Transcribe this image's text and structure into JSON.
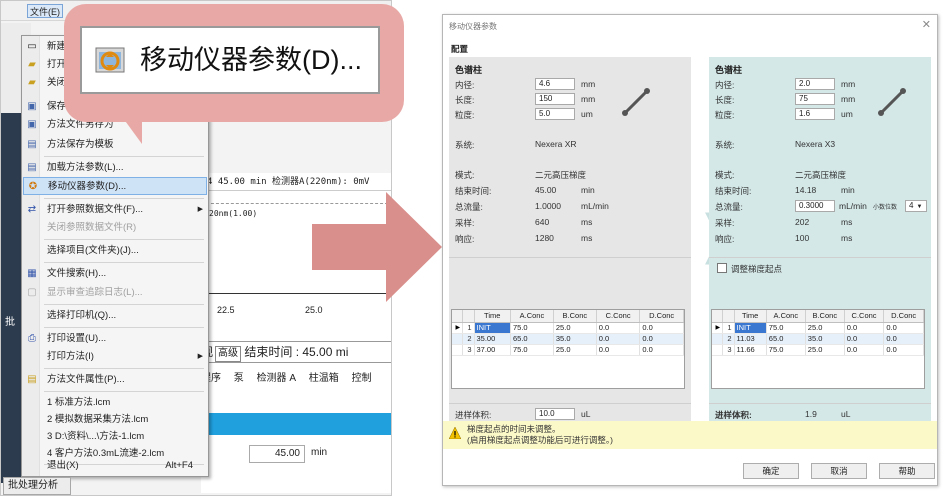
{
  "host_app": {
    "menubar": {
      "file_tab": "文件(E)"
    },
    "background": {
      "header_row": "4 45.00 min 检测器A(220nm): 0mV",
      "chart_label": "20nm(1.00)",
      "ticks": [
        "22.5",
        "25.0"
      ],
      "runtime_row": {
        "prefix": "观",
        "tag": "高级",
        "text": "结束时间 : 45.00 mi"
      },
      "tabs": [
        "程序",
        "泵",
        "检测器 A",
        "柱温箱",
        "控制"
      ],
      "time_value": "45.00",
      "time_unit": "min"
    },
    "bottom_tab": "批处理分析",
    "side_char": "批"
  },
  "file_menu": {
    "items": [
      {
        "label": "新建",
        "icon": "new-file-icon"
      },
      {
        "label": "打开",
        "icon": "open-folder-icon"
      },
      {
        "label": "关闭",
        "icon": "close-file-icon"
      },
      {
        "label": "保存",
        "icon": "save-icon"
      },
      {
        "label": "方法文件另存为",
        "icon": "save-as-icon"
      },
      {
        "label": "方法保存为模板",
        "icon": "template-icon"
      },
      {
        "label": "加载方法参数(L)...",
        "icon": "load-params-icon"
      },
      {
        "label": "移动仪器参数(D)...",
        "icon": "transfer-params-icon"
      },
      {
        "label": "打开参照数据文件(F)...",
        "icon": "reference-file-icon"
      },
      {
        "label": "关闭参照数据文件(R)",
        "icon": ""
      },
      {
        "label": "选择项目(文件夹)(J)...",
        "icon": ""
      },
      {
        "label": "文件搜索(H)...",
        "icon": "file-search-icon"
      },
      {
        "label": "显示审查追踪日志(L)...",
        "icon": "audit-log-icon"
      },
      {
        "label": "选择打印机(Q)...",
        "icon": ""
      },
      {
        "label": "打印设置(U)...",
        "icon": "print-setup-icon"
      },
      {
        "label": "打印方法(I)",
        "icon": ""
      },
      {
        "label": "方法文件属性(P)...",
        "icon": "properties-icon"
      },
      {
        "label": "1 标准方法.lcm",
        "icon": ""
      },
      {
        "label": "2 模拟数据采集方法.lcm",
        "icon": ""
      },
      {
        "label": "3 D:\\资料\\...\\方法-1.lcm",
        "icon": ""
      },
      {
        "label": "4 客户方法0.3mL流速-2.lcm",
        "icon": ""
      },
      {
        "label": "退出(X)",
        "shortcut": "Alt+F4",
        "icon": ""
      }
    ]
  },
  "callout": {
    "text": "移动仪器参数(D)..."
  },
  "dialog": {
    "title": "移动仪器参数",
    "close_glyph": "✕",
    "config_label": "配置",
    "source": {
      "section": "色谱柱",
      "inner_diameter": {
        "label": "内径:",
        "value": "4.6",
        "unit": "mm"
      },
      "length": {
        "label": "长度:",
        "value": "150",
        "unit": "mm"
      },
      "particle": {
        "label": "粒度:",
        "value": "5.0",
        "unit": "um"
      },
      "system": {
        "label": "系统:",
        "value": "Nexera XR"
      },
      "mode": {
        "label": "模式:",
        "value": "二元高压梯度"
      },
      "end_time": {
        "label": "结束时间:",
        "value": "45.00",
        "unit": "min"
      },
      "total_flow": {
        "label": "总流量:",
        "value": "1.0000",
        "unit": "mL/min"
      },
      "sampling": {
        "label": "采样:",
        "value": "640",
        "unit": "ms"
      },
      "response": {
        "label": "响应:",
        "value": "1280",
        "unit": "ms"
      },
      "injection": {
        "label": "进样体积:",
        "value": "10.0",
        "unit": "uL"
      }
    },
    "target": {
      "section": "色谱柱",
      "inner_diameter": {
        "label": "内径:",
        "value": "2.0",
        "unit": "mm"
      },
      "length": {
        "label": "长度:",
        "value": "75",
        "unit": "mm"
      },
      "particle": {
        "label": "粒度:",
        "value": "1.6",
        "unit": "um"
      },
      "system": {
        "label": "系统:",
        "value": "Nexera X3"
      },
      "mode": {
        "label": "模式:",
        "value": "二元高压梯度"
      },
      "end_time": {
        "label": "结束时间:",
        "value": "14.18",
        "unit": "min"
      },
      "total_flow": {
        "label": "总流量:",
        "value": "0.3000",
        "unit": "mL/min"
      },
      "decimal_label": "小数位数",
      "decimal_value": "4",
      "sampling": {
        "label": "采样:",
        "value": "202",
        "unit": "ms"
      },
      "response": {
        "label": "响应:",
        "value": "100",
        "unit": "ms"
      },
      "adjust_gradient": "调整梯度起点",
      "injection": {
        "label": "进样体积:",
        "value": "1.9",
        "unit": "uL"
      }
    },
    "table_headers": [
      "Time",
      "A.Conc",
      "B.Conc",
      "C.Conc",
      "D.Conc"
    ],
    "source_rows": [
      [
        "1",
        "INIT",
        "75.0",
        "25.0",
        "0.0",
        "0.0"
      ],
      [
        "2",
        "35.00",
        "65.0",
        "35.0",
        "0.0",
        "0.0"
      ],
      [
        "3",
        "37.00",
        "75.0",
        "25.0",
        "0.0",
        "0.0"
      ]
    ],
    "target_rows": [
      [
        "1",
        "INIT",
        "75.0",
        "25.0",
        "0.0",
        "0.0"
      ],
      [
        "2",
        "11.03",
        "65.0",
        "35.0",
        "0.0",
        "0.0"
      ],
      [
        "3",
        "11.66",
        "75.0",
        "25.0",
        "0.0",
        "0.0"
      ]
    ],
    "warning_line1": "梯度起点的时间未调整。",
    "warning_line2": "(启用梯度起点调整功能后可进行调整。)",
    "buttons": {
      "ok": "确定",
      "cancel": "取消",
      "help": "帮助"
    }
  },
  "colors": {
    "callout": "#e8a9a6",
    "arrow": "#d98f8b",
    "selection": "#cfe3f7",
    "target_panel": "#d5e8e8",
    "warning": "#fcf9c8"
  }
}
